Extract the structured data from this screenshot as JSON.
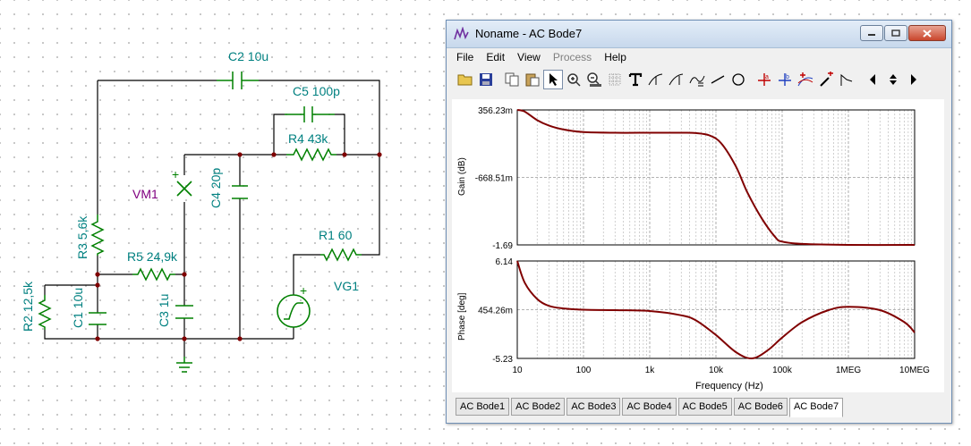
{
  "schematic": {
    "labels": {
      "c2": "C2 10u",
      "c5": "C5 100p",
      "r4": "R4 43k",
      "vm1": "VM1",
      "c4": "C4 20p",
      "r3": "R3 5,6k",
      "r5": "R5 24,9k",
      "r1": "R1 60",
      "vg1": "VG1",
      "r2": "R2 12,5k",
      "c1": "C1 10u",
      "c3": "C3 1u"
    },
    "plus": "+",
    "colors": {
      "wire": "#000000",
      "component": "#008000",
      "label": "#008080",
      "meter": "#800080",
      "node": "#800000"
    }
  },
  "window": {
    "title": "Noname - AC Bode7",
    "menu": [
      "File",
      "Edit",
      "View",
      "Process",
      "Help"
    ],
    "disabled_menu": "Process"
  },
  "toolbar": {
    "icons": [
      "open-icon",
      "save-icon",
      "copy-icon",
      "paste-icon",
      "pointer-icon",
      "zoom-in-icon",
      "zoom-100-icon",
      "grid-icon",
      "text-tool-icon",
      "cursor-a-icon",
      "cursor-b-icon",
      "curve-tool-icon",
      "line-icon",
      "circle-icon",
      "cursor-a-marker-icon",
      "cursor-b-marker-icon",
      "add-curve-icon",
      "probe-icon",
      "graph-icon",
      "left-arrow-icon",
      "up-down-icon",
      "right-arrow-icon"
    ]
  },
  "chart_data": [
    {
      "type": "line",
      "ylabel": "Gain (dB)",
      "x_scale": "log",
      "xlim": [
        10,
        10000000
      ],
      "ylim": [
        -1.69,
        356.23
      ],
      "y_tick_labels": [
        "356.23m",
        "-668.51m",
        "-1.69"
      ],
      "grid": true,
      "color": "#800000",
      "series": [
        {
          "x": [
            10,
            13,
            20,
            30,
            50,
            100,
            300,
            1000,
            3000,
            5000,
            8000,
            12000,
            20000,
            30000,
            50000,
            80000,
            100000,
            200000,
            1000000,
            10000000
          ],
          "y": [
            356.23,
            330,
            200,
            120,
            60,
            20,
            10,
            10,
            10,
            5,
            -30,
            -150,
            -500,
            -900,
            -1300,
            -1580,
            -1640,
            -1675,
            -1690,
            -1690
          ]
        }
      ]
    },
    {
      "type": "line",
      "ylabel": "Phase [deg]",
      "xlabel": "Frequency (Hz)",
      "x_scale": "log",
      "xlim": [
        10,
        10000000
      ],
      "ylim": [
        -5.23,
        6.14
      ],
      "y_tick_labels": [
        "6.14",
        "454.26m",
        "-5.23"
      ],
      "x_tick_labels": [
        "10",
        "100",
        "1k",
        "10k",
        "100k",
        "1MEG",
        "10MEG"
      ],
      "grid": true,
      "color": "#800000",
      "series": [
        {
          "x": [
            10,
            13,
            20,
            30,
            50,
            100,
            300,
            1000,
            3000,
            5000,
            10000,
            20000,
            35000,
            60000,
            100000,
            200000,
            500000,
            1000000,
            3000000,
            7000000,
            10000000
          ],
          "y": [
            6.14,
            3.6,
            1.7,
            0.9,
            0.6,
            0.45,
            0.4,
            0.3,
            -0.2,
            -0.8,
            -2.5,
            -4.5,
            -5.23,
            -4.3,
            -2.8,
            -1.0,
            0.4,
            0.8,
            0.4,
            -1.0,
            -2.2
          ]
        }
      ]
    }
  ],
  "tabs": [
    "AC Bode1",
    "AC Bode2",
    "AC Bode3",
    "AC Bode4",
    "AC Bode5",
    "AC Bode6",
    "AC Bode7"
  ],
  "active_tab": "AC Bode7"
}
